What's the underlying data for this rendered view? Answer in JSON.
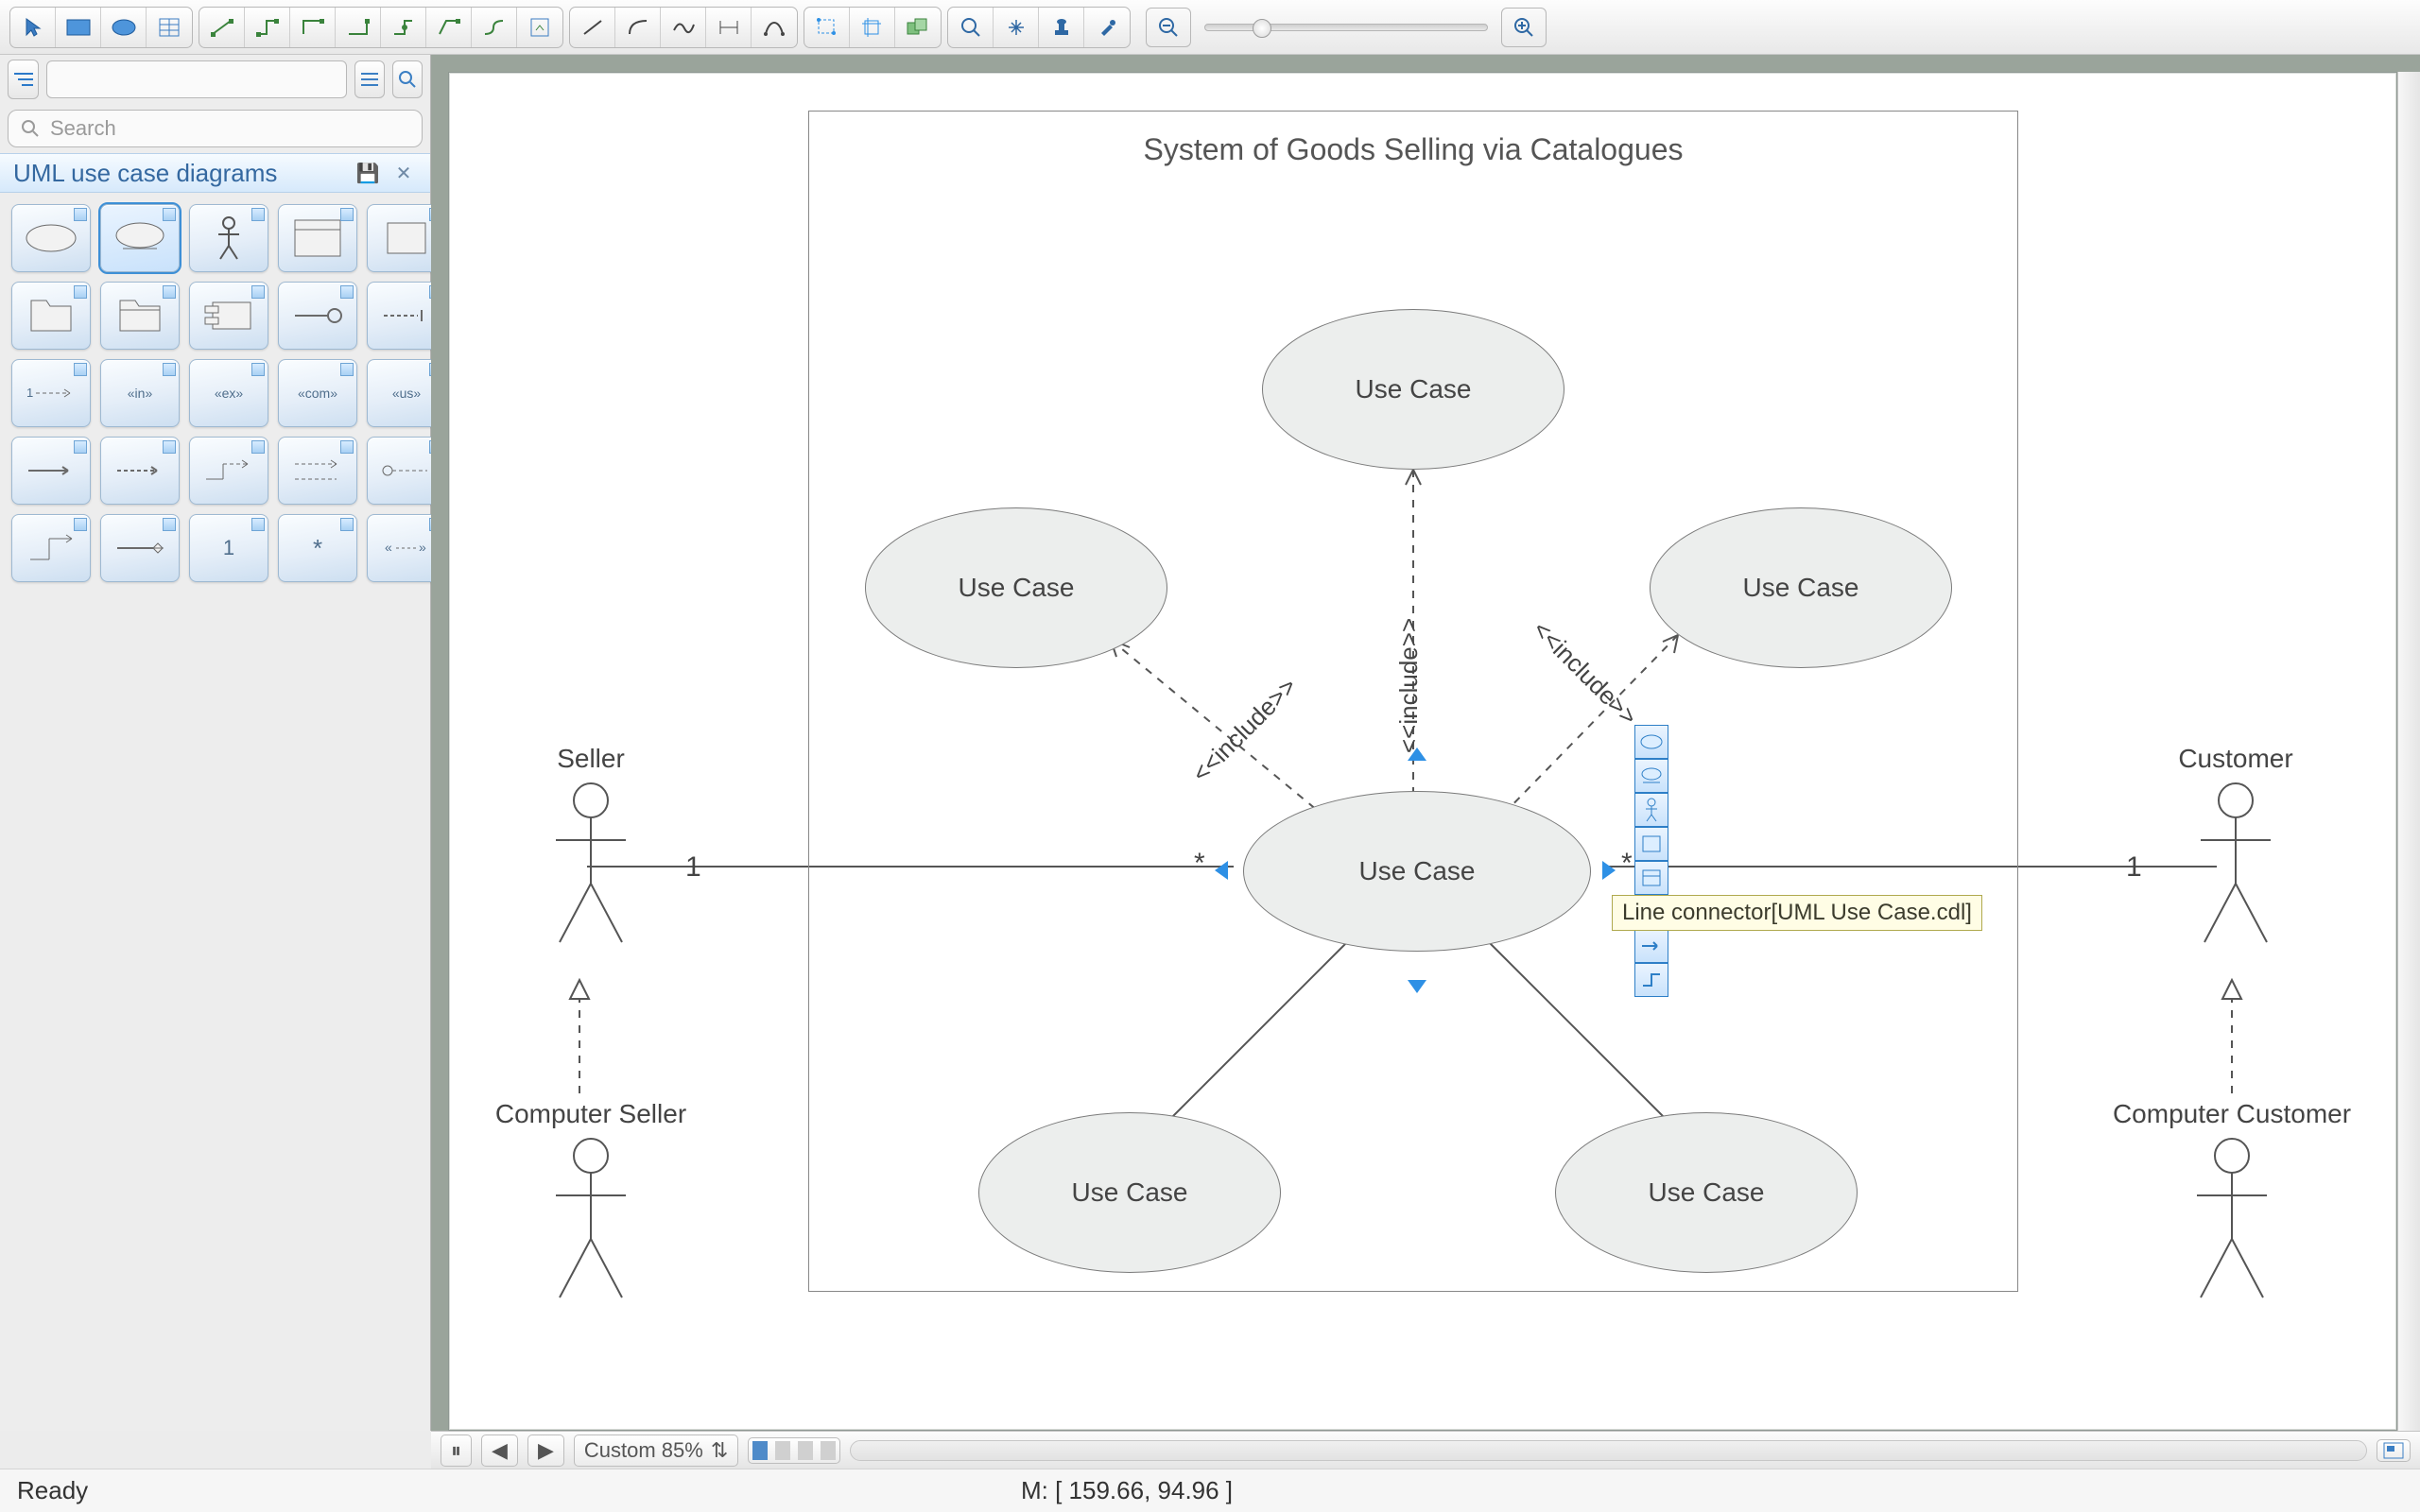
{
  "sidebar": {
    "search_placeholder": "Search",
    "panel_title": "UML use case diagrams",
    "stencils": [
      {
        "name": "use-case"
      },
      {
        "name": "use-case-ext"
      },
      {
        "name": "actor"
      },
      {
        "name": "system-boundary"
      },
      {
        "name": "package"
      },
      {
        "name": "folder"
      },
      {
        "name": "folder-open"
      },
      {
        "name": "component"
      },
      {
        "name": "interface"
      },
      {
        "name": "constraint"
      },
      {
        "name": "assoc-1"
      },
      {
        "name": "stereo-in",
        "label": "«in»"
      },
      {
        "name": "stereo-ex",
        "label": "«ex»"
      },
      {
        "name": "stereo-com",
        "label": "«com»"
      },
      {
        "name": "stereo-us",
        "label": "«us»"
      },
      {
        "name": "arrow-r"
      },
      {
        "name": "dash-arrow"
      },
      {
        "name": "realize"
      },
      {
        "name": "dependency"
      },
      {
        "name": "lollipop"
      },
      {
        "name": "branch"
      },
      {
        "name": "gen-arrow"
      },
      {
        "name": "mult-1",
        "label": "1"
      },
      {
        "name": "mult-star",
        "label": "*"
      },
      {
        "name": "nav"
      }
    ]
  },
  "diagram": {
    "title": "System of Goods Selling via Catalogues",
    "use_cases": {
      "top": "Use Case",
      "left": "Use Case",
      "right": "Use Case",
      "center": "Use Case",
      "bl": "Use Case",
      "br": "Use Case"
    },
    "actors": {
      "seller": "Seller",
      "cseller": "Computer Seller",
      "customer": "Customer",
      "ccustomer": "Computer Customer"
    },
    "include_label": "<<include>>",
    "mult_1": "1",
    "mult_star": "*"
  },
  "tooltip": "Line connector[UML Use Case.cdl]",
  "bottom": {
    "zoom_label": "Custom 85%"
  },
  "status": {
    "ready": "Ready",
    "coords": "M: [ 159.66, 94.96 ]"
  }
}
